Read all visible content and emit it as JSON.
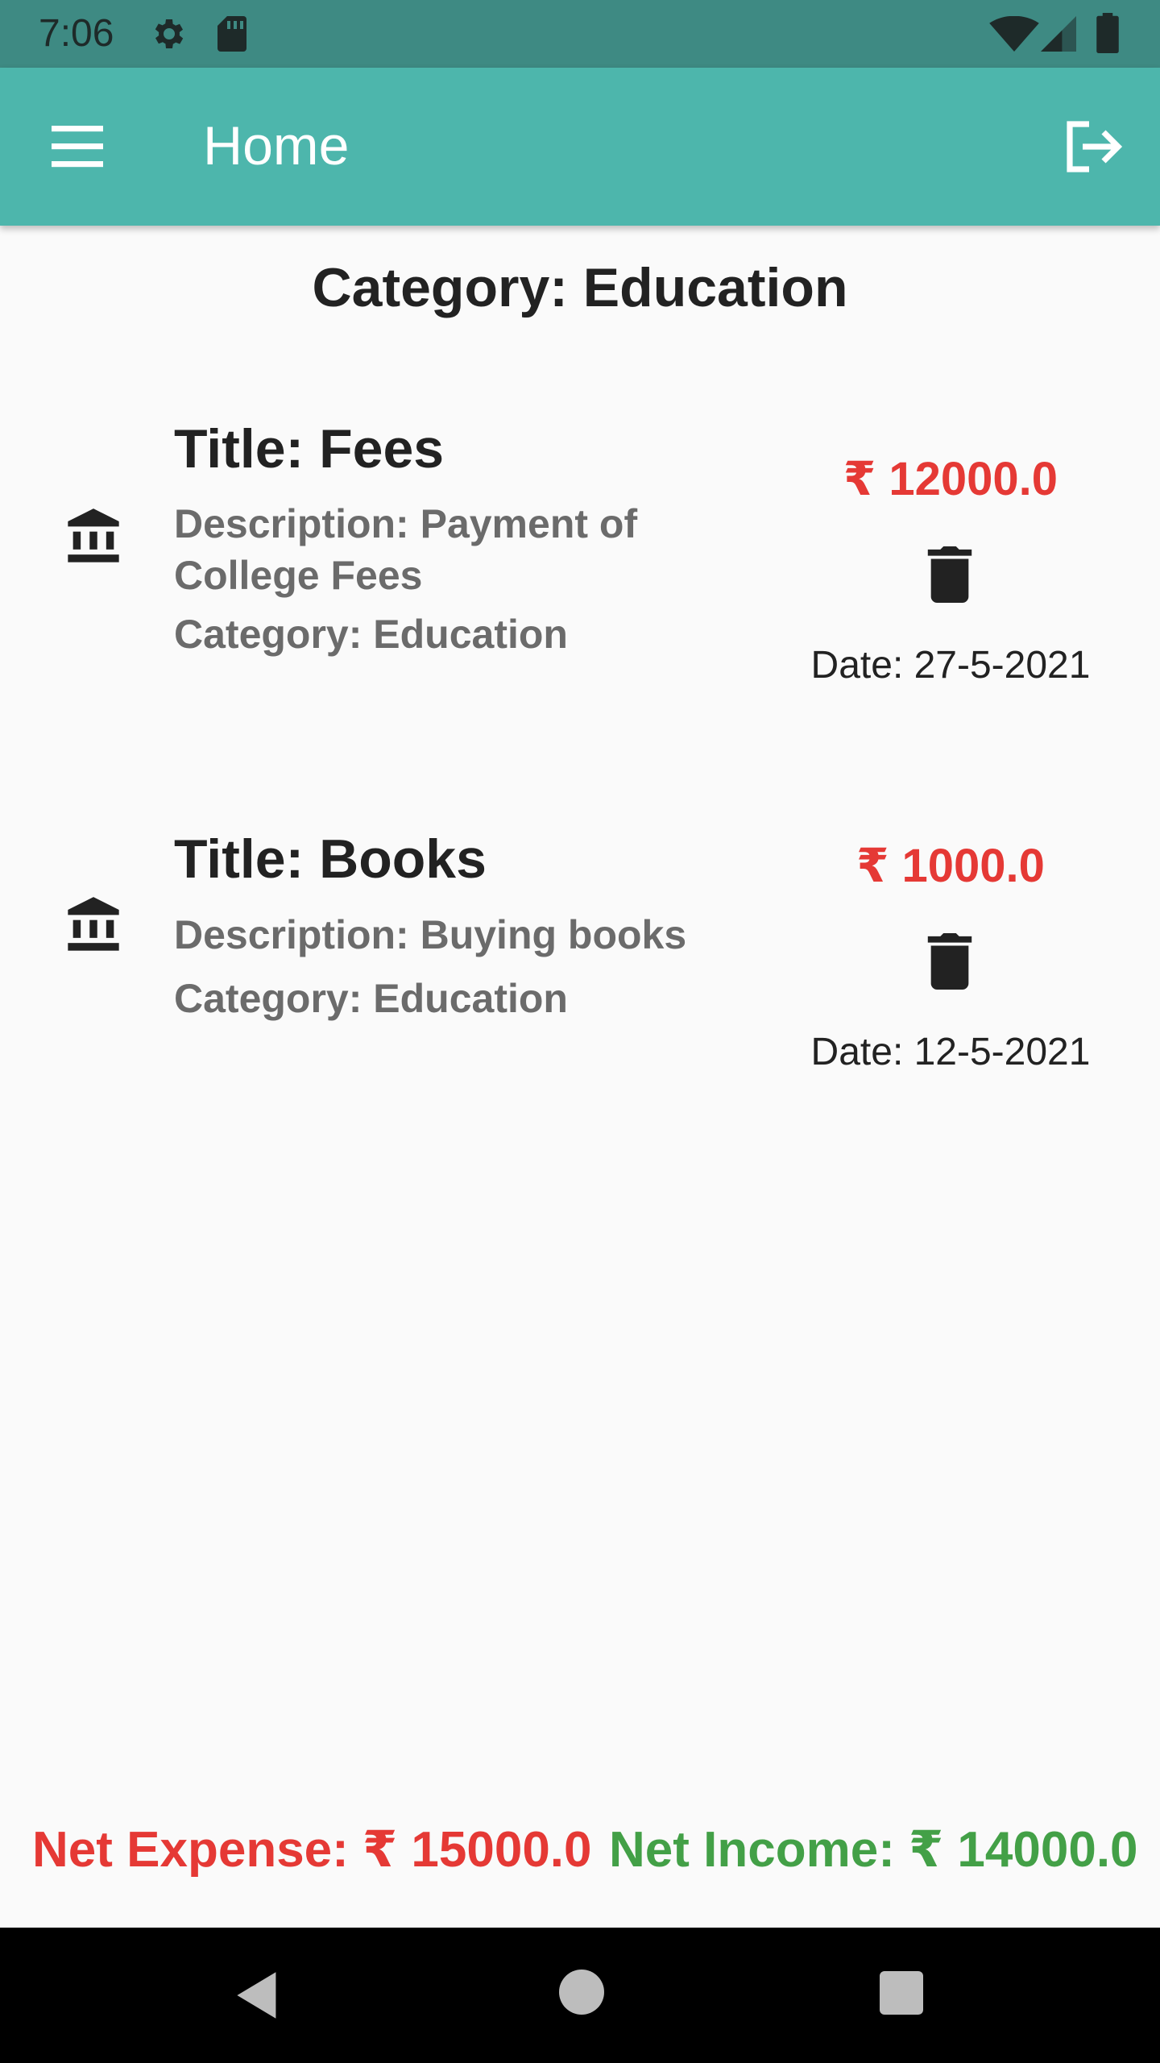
{
  "status_bar": {
    "time": "7:06",
    "icons": [
      "gear-icon",
      "sd-card-icon",
      "wifi-icon",
      "signal-icon",
      "battery-icon"
    ]
  },
  "app_bar": {
    "title": "Home",
    "left_icon": "menu-icon",
    "right_icon": "logout-icon",
    "color": "#4db6ac"
  },
  "category_header": "Category: Education",
  "items": [
    {
      "icon": "bank-icon",
      "title": "Title: Fees",
      "description": "Description: Payment of College Fees",
      "category": "Category: Education",
      "amount": "₹ 12000.0",
      "date": "Date: 27-5-2021",
      "action_icon": "delete-icon"
    },
    {
      "icon": "bank-icon",
      "title": "Title: Books",
      "description": "Description: Buying books",
      "category": "Category: Education",
      "amount": "₹ 1000.0",
      "date": "Date: 12-5-2021",
      "action_icon": "delete-icon"
    }
  ],
  "totals": {
    "net_expense": "Net Expense: ₹ 15000.0",
    "net_income": "Net Income: ₹ 14000.0",
    "expense_color": "#e53935",
    "income_color": "#43a047"
  },
  "nav_bar": {
    "icons": [
      "back-icon",
      "home-icon",
      "recents-icon"
    ]
  }
}
